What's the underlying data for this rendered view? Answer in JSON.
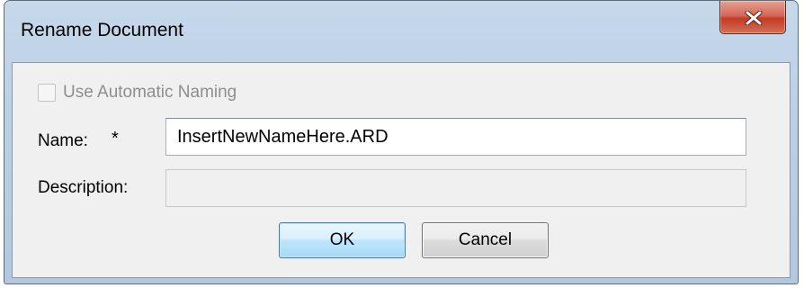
{
  "window": {
    "title": "Rename Document",
    "close_icon": "close-icon",
    "close_color": "#c53a22"
  },
  "form": {
    "auto_naming": {
      "label": "Use Automatic Naming",
      "checked": false,
      "enabled": false
    },
    "name": {
      "label": "Name:",
      "required_marker": "*",
      "value": "InsertNewNameHere.ARD"
    },
    "description": {
      "label": "Description:",
      "value": "",
      "enabled": false
    }
  },
  "buttons": {
    "ok_label": "OK",
    "cancel_label": "Cancel"
  }
}
